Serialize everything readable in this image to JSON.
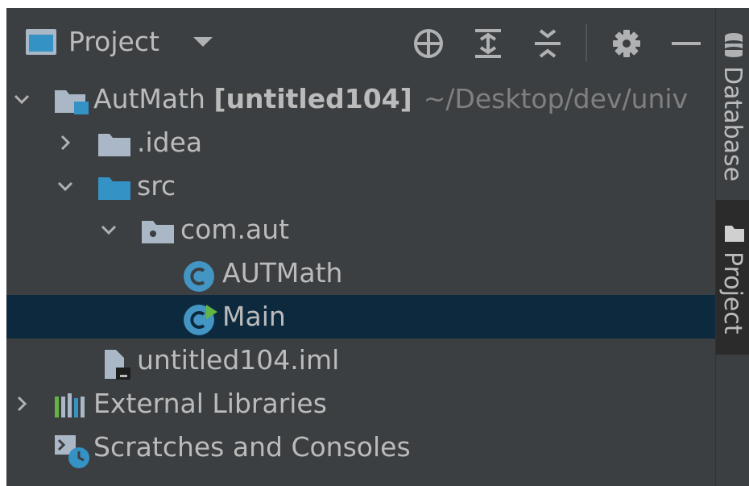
{
  "header": {
    "title": "Project",
    "icons": [
      "project-view-icon",
      "dropdown-arrow-icon",
      "locate-icon",
      "expand-all-icon",
      "collapse-all-icon",
      "settings-gear-icon",
      "hide-minus-icon"
    ]
  },
  "tree": {
    "root": {
      "name": "AutMath",
      "module": "[untitled104]",
      "path": "~/Desktop/dev/univ",
      "expanded": true
    },
    "idea": {
      "name": ".idea",
      "expanded": false
    },
    "src": {
      "name": "src",
      "expanded": true
    },
    "package": {
      "name": "com.aut",
      "expanded": true
    },
    "class_autmath": {
      "name": "AUTMath"
    },
    "class_main": {
      "name": "Main",
      "selected": true
    },
    "iml": {
      "name": "untitled104.iml"
    },
    "external": {
      "name": "External Libraries",
      "expanded": false
    },
    "scratches": {
      "name": "Scratches and Consoles"
    }
  },
  "sidebar": {
    "database_label": "Database",
    "project_label": "Project",
    "active_tab": "Project"
  },
  "colors": {
    "panel_bg": "#3c3f41",
    "selection_bg": "#0d293e",
    "text": "#bbbbbb",
    "path_text": "#808080",
    "folder_gray": "#a9b7c6",
    "source_blue": "#3592c4",
    "class_circle": "#4395c4",
    "run_green": "#62b543"
  }
}
